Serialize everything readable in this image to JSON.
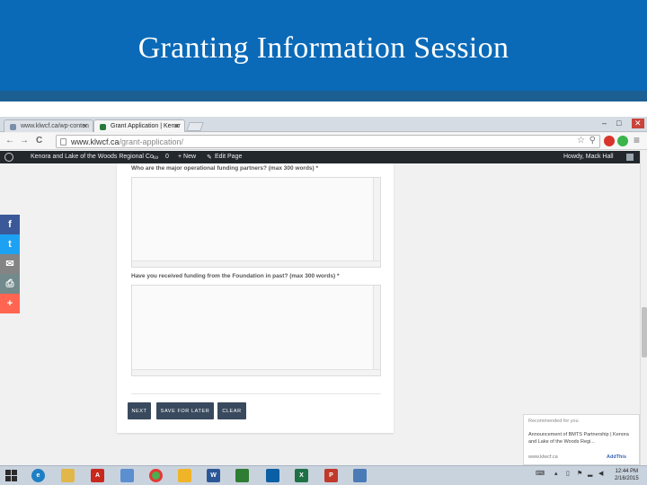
{
  "slide": {
    "title": "Granting Information Session"
  },
  "browser": {
    "tabs": [
      {
        "label": "www.klwcf.ca/wp-conten"
      },
      {
        "label": "Grant Application | Kenor"
      }
    ],
    "window_controls": {
      "minimize": "–",
      "restore": "□",
      "close": "✕"
    },
    "nav": {
      "back": "←",
      "forward": "→",
      "reload": "C"
    },
    "url_domain": "www.klwcf.ca",
    "url_path": "/grant-application/",
    "menu_glyph": "≡"
  },
  "admin_bar": {
    "site_name": "Kenora and Lake of the Woods Regional Co...",
    "comments_count": "0",
    "new_label": "+ New",
    "edit_label": "Edit Page",
    "greeting": "Howdy, Mack Hall"
  },
  "form": {
    "question_1": "Who are the major operational funding partners? (max 300 words) *",
    "question_2": "Have you received funding from the Foundation in past? (max 300 words) *",
    "answer_1": "",
    "answer_2": "",
    "buttons": {
      "next": "NEXT",
      "save": "SAVE FOR LATER",
      "clear": "CLEAR"
    }
  },
  "social": {
    "facebook": "f",
    "twitter": "t",
    "email": "✉",
    "print": "⎙",
    "more": "+"
  },
  "recommendation": {
    "label": "Recommended for you",
    "text": "Announcement of BMTS Partnership | Kenora and Lake of the Woods Regi...",
    "source": "www.klwcf.ca",
    "brand": "AddThis"
  },
  "taskbar": {
    "time": "12:44 PM",
    "date": "2/16/2015"
  },
  "colors": {
    "slide_header": "#0a6ab8",
    "facebook": "#3b5998",
    "twitter": "#1da1f2",
    "email": "#848484",
    "print": "#738a8d",
    "more": "#ff6550",
    "button": "#3a4a5e"
  }
}
